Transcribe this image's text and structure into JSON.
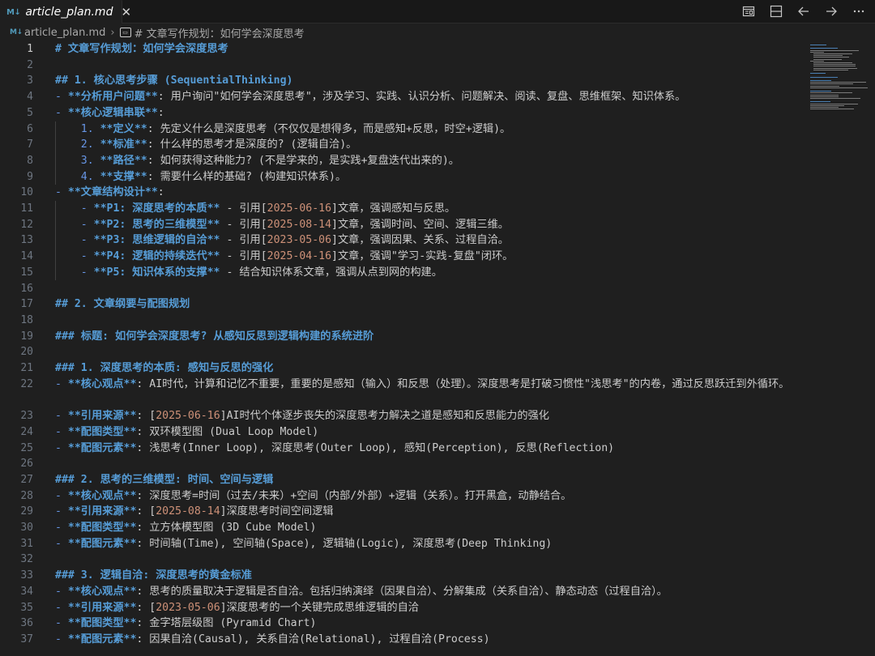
{
  "tab": {
    "icon": "markdown-icon",
    "icon_text": "M↓",
    "title": "article_plan.md",
    "close": "✕"
  },
  "breadcrumb": {
    "file": "article_plan.md",
    "sep": "›",
    "symbol": "# 文章写作规划：如何学会深度思考"
  },
  "colors": {
    "background": "#1f1f1f",
    "heading": "#569cd6",
    "text": "#cccccc",
    "number_link": "#ce9178",
    "line_number": "#6e7681"
  },
  "active_line": 1,
  "lines": [
    [
      [
        "h",
        "# 文章写作规划：如何学会深度思考"
      ]
    ],
    [],
    [
      [
        "h",
        "## 1. 核心思考步骤 (SequentialThinking)"
      ]
    ],
    [
      [
        "d",
        "- "
      ],
      [
        "b",
        "**分析用户问题**"
      ],
      [
        "t",
        ": 用户询问\"如何学会深度思考\"，涉及学习、实践、认识分析、问题解决、阅读、复盘、思维框架、知识体系。"
      ]
    ],
    [
      [
        "d",
        "- "
      ],
      [
        "b",
        "**核心逻辑串联**"
      ],
      [
        "t",
        ":"
      ]
    ],
    [
      [
        "d",
        "    1. "
      ],
      [
        "b",
        "**定义**"
      ],
      [
        "t",
        ": 先定义什么是深度思考（不仅仅是想得多，而是感知+反思，时空+逻辑)。"
      ]
    ],
    [
      [
        "d",
        "    2. "
      ],
      [
        "b",
        "**标准**"
      ],
      [
        "t",
        ": 什么样的思考才是深度的? (逻辑自洽)。"
      ]
    ],
    [
      [
        "d",
        "    3. "
      ],
      [
        "b",
        "**路径**"
      ],
      [
        "t",
        ": 如何获得这种能力? (不是学来的，是实践+复盘迭代出来的)。"
      ]
    ],
    [
      [
        "d",
        "    4. "
      ],
      [
        "b",
        "**支撑**"
      ],
      [
        "t",
        ": 需要什么样的基础? (构建知识体系)。"
      ]
    ],
    [
      [
        "d",
        "- "
      ],
      [
        "b",
        "**文章结构设计**"
      ],
      [
        "t",
        ":"
      ]
    ],
    [
      [
        "d",
        "    - "
      ],
      [
        "b",
        "**P1: 深度思考的本质**"
      ],
      [
        "t",
        " - 引用["
      ],
      [
        "n",
        "2025-06-16"
      ],
      [
        "t",
        "]文章，强调感知与反思。"
      ]
    ],
    [
      [
        "d",
        "    - "
      ],
      [
        "b",
        "**P2: 思考的三维模型**"
      ],
      [
        "t",
        " - 引用["
      ],
      [
        "n",
        "2025-08-14"
      ],
      [
        "t",
        "]文章，强调时间、空间、逻辑三维。"
      ]
    ],
    [
      [
        "d",
        "    - "
      ],
      [
        "b",
        "**P3: 思维逻辑的自洽**"
      ],
      [
        "t",
        " - 引用["
      ],
      [
        "n",
        "2023-05-06"
      ],
      [
        "t",
        "]文章，强调因果、关系、过程自洽。"
      ]
    ],
    [
      [
        "d",
        "    - "
      ],
      [
        "b",
        "**P4: 逻辑的持续迭代**"
      ],
      [
        "t",
        " - 引用["
      ],
      [
        "n",
        "2025-04-16"
      ],
      [
        "t",
        "]文章，强调\"学习-实践-复盘\"闭环。"
      ]
    ],
    [
      [
        "d",
        "    - "
      ],
      [
        "b",
        "**P5: 知识体系的支撑**"
      ],
      [
        "t",
        " - 结合知识体系文章，强调从点到网的构建。"
      ]
    ],
    [],
    [
      [
        "h",
        "## 2. 文章纲要与配图规划"
      ]
    ],
    [],
    [
      [
        "h",
        "### 标题: 如何学会深度思考? 从感知反思到逻辑构建的系统进阶"
      ]
    ],
    [],
    [
      [
        "h",
        "### 1. 深度思考的本质: 感知与反思的强化"
      ]
    ],
    [
      [
        "d",
        "- "
      ],
      [
        "b",
        "**核心观点**"
      ],
      [
        "t",
        ": AI时代，计算和记忆不重要，重要的是感知（输入）和反思（处理）。深度思考是打破习惯性\"浅思考\"的内卷，通过反思跃迁到外循环。"
      ]
    ],
    [
      [
        "d",
        "- "
      ],
      [
        "b",
        "**引用来源**"
      ],
      [
        "t",
        ": ["
      ],
      [
        "n",
        "2025-06-16"
      ],
      [
        "t",
        "]AI时代个体逐步丧失的深度思考力解决之道是感知和反思能力的强化"
      ]
    ],
    [
      [
        "d",
        "- "
      ],
      [
        "b",
        "**配图类型**"
      ],
      [
        "t",
        ": 双环模型图 (Dual Loop Model)"
      ]
    ],
    [
      [
        "d",
        "- "
      ],
      [
        "b",
        "**配图元素**"
      ],
      [
        "t",
        ": 浅思考(Inner Loop), 深度思考(Outer Loop), 感知(Perception), 反思(Reflection)"
      ]
    ],
    [],
    [
      [
        "h",
        "### 2. 思考的三维模型: 时间、空间与逻辑"
      ]
    ],
    [
      [
        "d",
        "- "
      ],
      [
        "b",
        "**核心观点**"
      ],
      [
        "t",
        ": 深度思考=时间（过去/未来）+空间（内部/外部）+逻辑（关系）。打开黑盒，动静结合。"
      ]
    ],
    [
      [
        "d",
        "- "
      ],
      [
        "b",
        "**引用来源**"
      ],
      [
        "t",
        ": ["
      ],
      [
        "n",
        "2025-08-14"
      ],
      [
        "t",
        "]深度思考时间空间逻辑"
      ]
    ],
    [
      [
        "d",
        "- "
      ],
      [
        "b",
        "**配图类型**"
      ],
      [
        "t",
        ": 立方体模型图 (3D Cube Model)"
      ]
    ],
    [
      [
        "d",
        "- "
      ],
      [
        "b",
        "**配图元素**"
      ],
      [
        "t",
        ": 时间轴(Time), 空间轴(Space), 逻辑轴(Logic), 深度思考(Deep Thinking)"
      ]
    ],
    [],
    [
      [
        "h",
        "### 3. 逻辑自洽: 深度思考的黄金标准"
      ]
    ],
    [
      [
        "d",
        "- "
      ],
      [
        "b",
        "**核心观点**"
      ],
      [
        "t",
        ": 思考的质量取决于逻辑是否自洽。包括归纳演绎（因果自洽）、分解集成（关系自洽）、静态动态（过程自洽）。"
      ]
    ],
    [
      [
        "d",
        "- "
      ],
      [
        "b",
        "**引用来源**"
      ],
      [
        "t",
        ": ["
      ],
      [
        "n",
        "2023-05-06"
      ],
      [
        "t",
        "]深度思考的一个关键完成思维逻辑的自洽"
      ]
    ],
    [
      [
        "d",
        "- "
      ],
      [
        "b",
        "**配图类型**"
      ],
      [
        "t",
        ": 金字塔层级图 (Pyramid Chart)"
      ]
    ],
    [
      [
        "d",
        "- "
      ],
      [
        "b",
        "**配图元素**"
      ],
      [
        "t",
        ": 因果自洽(Causal), 关系自洽(Relational), 过程自洽(Process)"
      ]
    ]
  ]
}
